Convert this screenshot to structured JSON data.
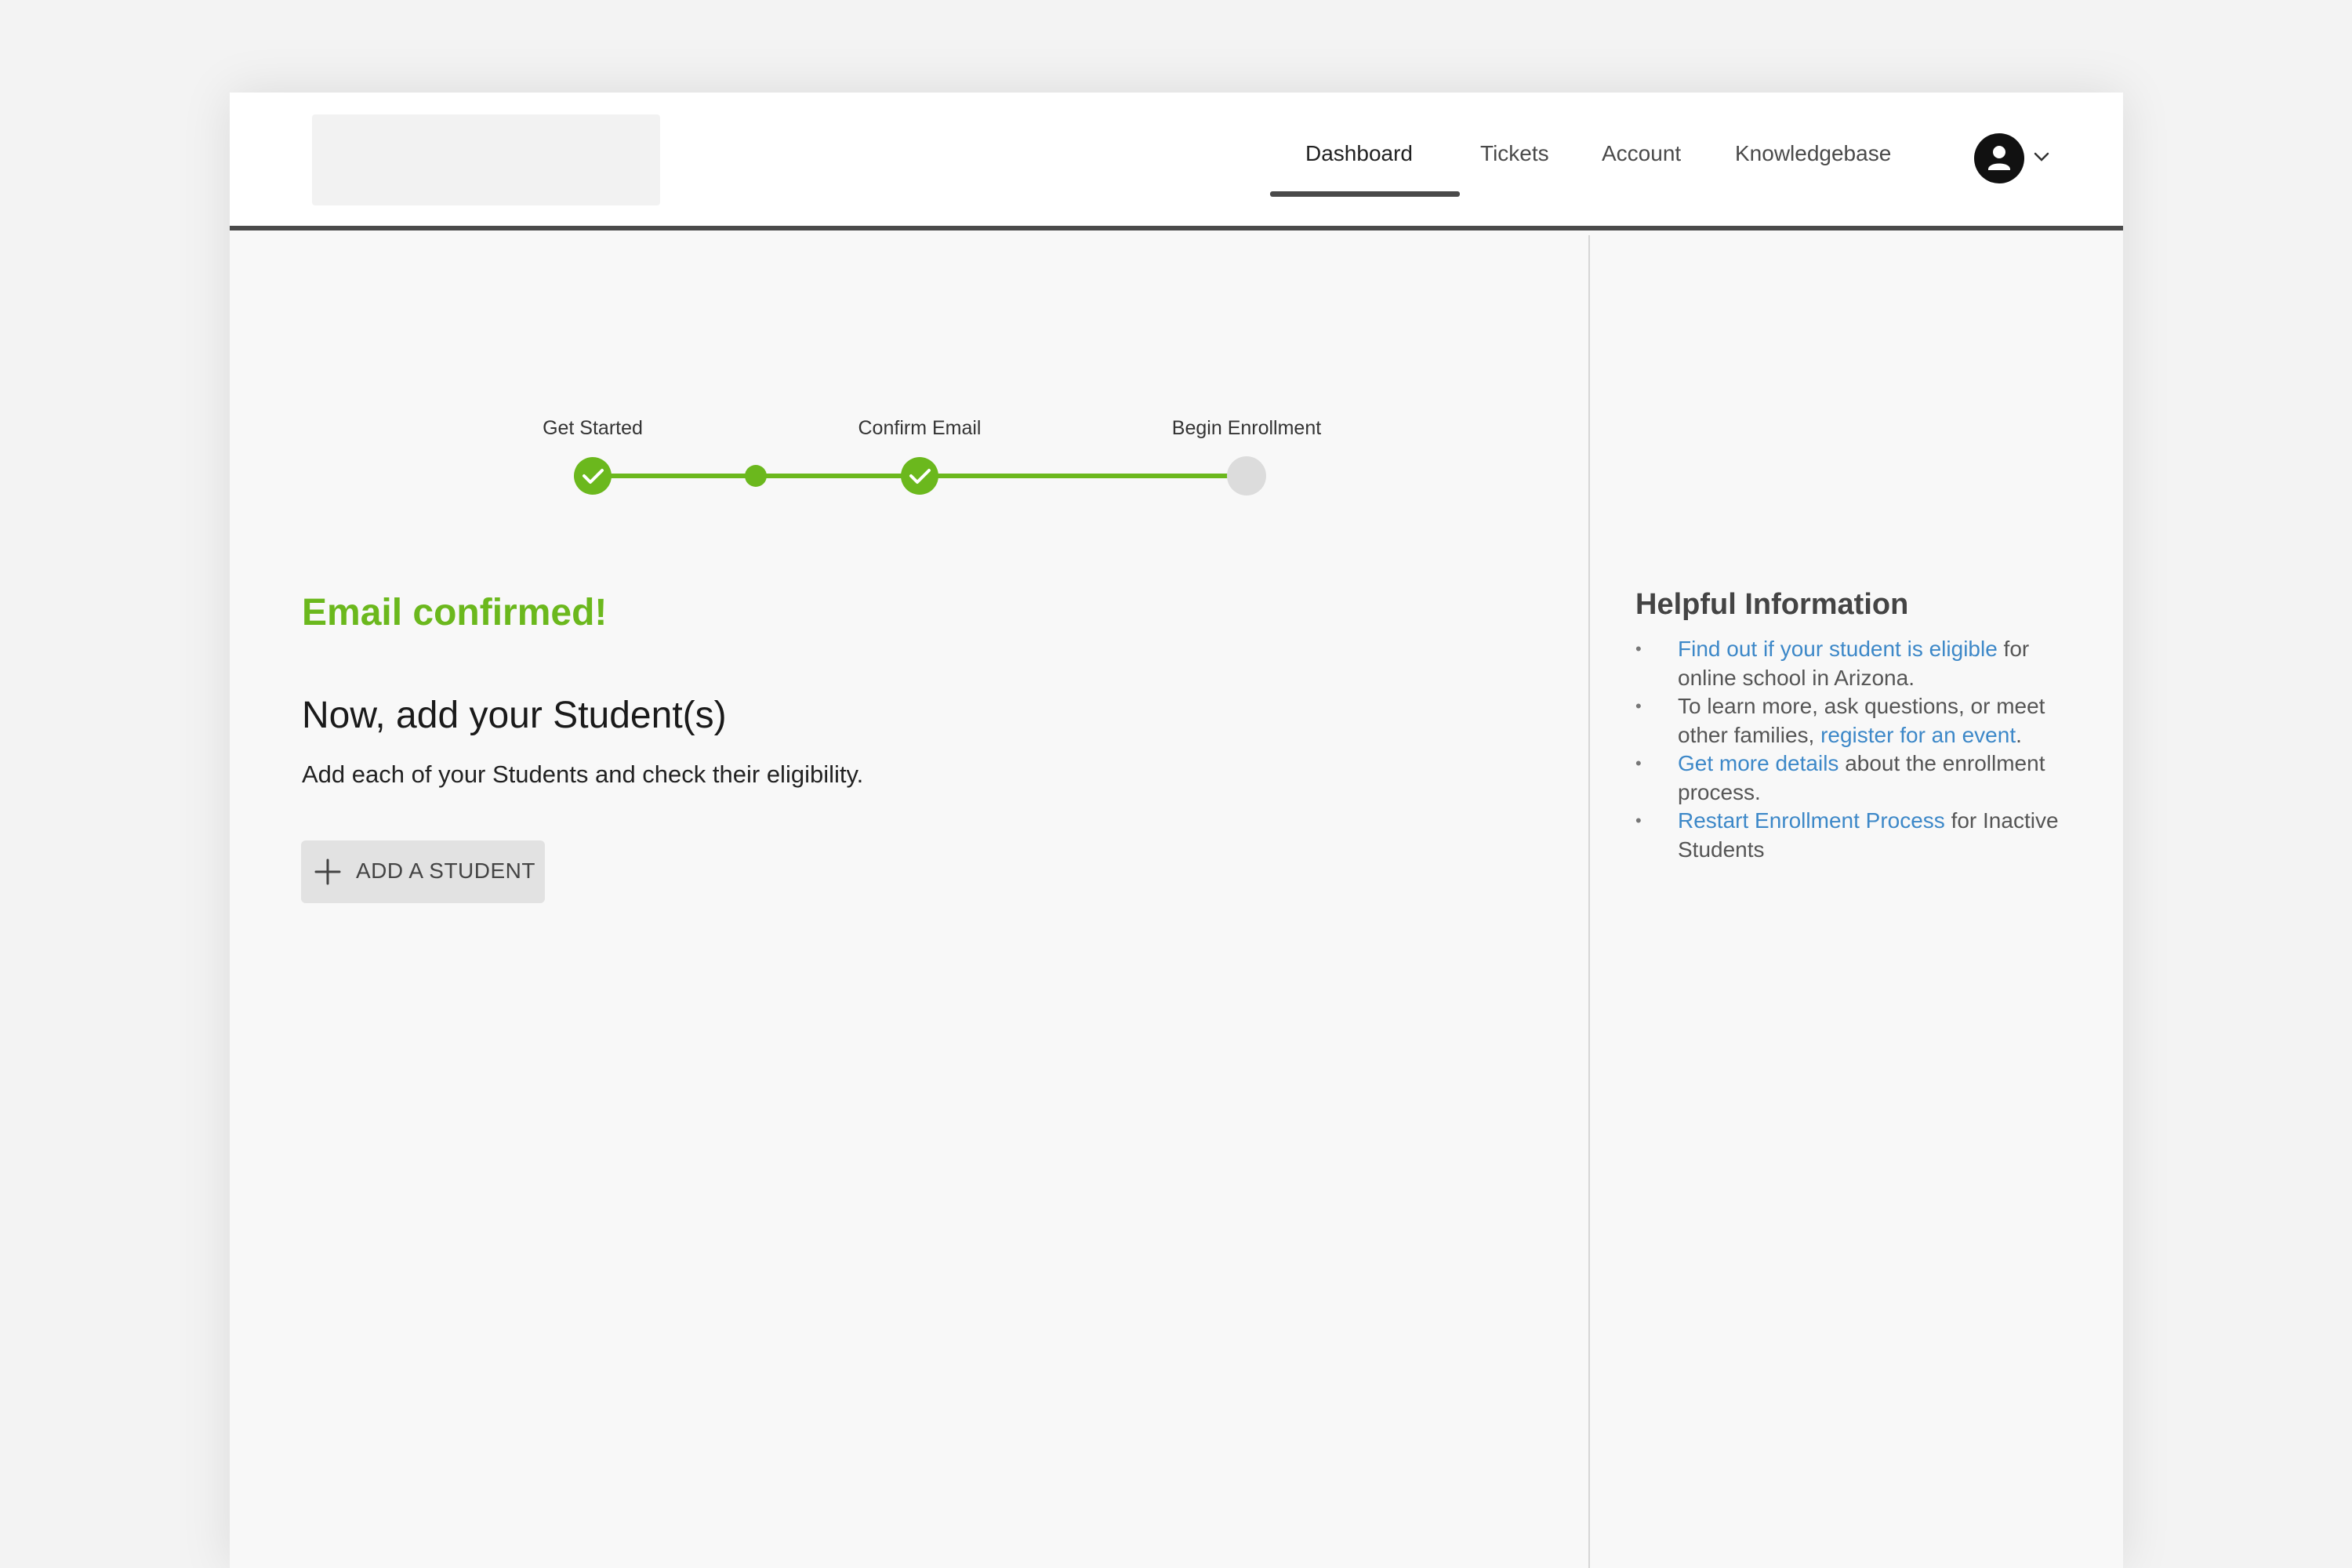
{
  "header": {
    "nav": [
      {
        "label": "Dashboard",
        "active": true
      },
      {
        "label": "Tickets",
        "active": false
      },
      {
        "label": "Account",
        "active": false
      },
      {
        "label": "Knowledgebase",
        "active": false
      }
    ],
    "user_icon": "user-avatar-icon",
    "menu_icon": "chevron-down-icon"
  },
  "stepper": {
    "steps": [
      {
        "label": "Get Started",
        "status": "complete"
      },
      {
        "label": "Confirm Email",
        "status": "complete"
      },
      {
        "label": "Begin Enrollment",
        "status": "pending"
      }
    ],
    "colors": {
      "complete": "#6bb81d",
      "pending": "#dcdcdc"
    }
  },
  "main": {
    "success_message": "Email confirmed!",
    "heading": "Now, add your Student(s)",
    "description": "Add each of your Students and check their eligibility.",
    "add_button_label": "ADD A STUDENT"
  },
  "sidebar": {
    "title": "Helpful Information",
    "items": [
      {
        "link": "Find out if your student is eligible",
        "text_after": " for online school in Arizona."
      },
      {
        "text_before": "To learn more, ask questions, or meet other families, ",
        "link": "register for an event",
        "text_after": "."
      },
      {
        "link": "Get more details",
        "text_after": " about the enrollment process."
      },
      {
        "link": "Restart Enrollment Process",
        "text_after": " for Inactive Students"
      }
    ]
  },
  "colors": {
    "accent": "#6bb81d",
    "link": "#3d88c8",
    "header_border": "#4a4a4a"
  }
}
